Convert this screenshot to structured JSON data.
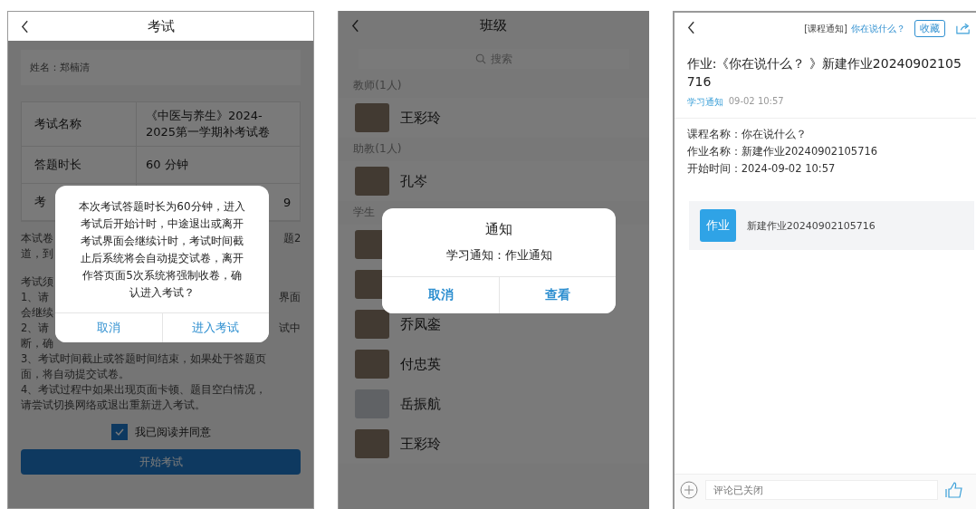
{
  "exam_screen": {
    "title": "考试",
    "name_field": "姓名：郑楠清",
    "info_rows": [
      {
        "label": "考试名称",
        "value": "《中医与养生》2024-2025第一学期补考试卷"
      },
      {
        "label": "答题时长",
        "value": "60 分钟"
      },
      {
        "label": "考",
        "value": "9"
      }
    ],
    "rule_paragraphs": [
      [
        {
          "left": "本试卷",
          "right": "题2"
        },
        {
          "left": "道，到"
        }
      ],
      [
        {
          "left": "考试须"
        },
        {
          "left": "1、请",
          "right": "界面"
        },
        {
          "left": "会继续"
        },
        {
          "left": "2、请",
          "right": "试中"
        },
        {
          "left": "断，确"
        },
        {
          "left": "3、考试时间截止或答题时间结束，如果处于答题页"
        },
        {
          "left": "面，将自动提交试卷。"
        },
        {
          "left": "4、考试过程中如果出现页面卡顿、题目空白情况，"
        },
        {
          "left": "请尝试切换网络或退出重新进入考试。"
        }
      ]
    ],
    "agree": {
      "label": "我已阅读并同意",
      "checked": true
    },
    "start_button": "开始考试",
    "dialog": {
      "message": "本次考试答题时长为60分钟，进入考试后开始计时，中途退出或离开考试界面会继续计时，考试时间截止后系统将会自动提交试卷，离开作答页面5次系统将强制收卷，确认进入考试？",
      "buttons": [
        "取消",
        "进入考试"
      ]
    }
  },
  "class_screen": {
    "title": "班级",
    "search": {
      "placeholder": "搜索"
    },
    "groups": [
      {
        "header": "教师(1人)",
        "members": [
          {
            "default_avatar": false,
            "name": "王彩玲"
          }
        ]
      },
      {
        "header": "助教(1人)",
        "members": [
          {
            "default_avatar": false,
            "name": "孔岑"
          }
        ]
      },
      {
        "header": "学生",
        "members": [
          {
            "default_avatar": false
          },
          {
            "default_avatar": false
          },
          {
            "default_avatar": false,
            "name": "乔凤銮"
          },
          {
            "default_avatar": false,
            "name": "付忠英"
          },
          {
            "default_avatar": true,
            "name": "岳振航"
          },
          {
            "default_avatar": false,
            "name": "王彩玲"
          }
        ]
      }
    ],
    "dialog": {
      "title": "通知",
      "message": "学习通知：作业通知",
      "buttons": [
        "取消",
        "查看"
      ]
    }
  },
  "notice_screen": {
    "header": {
      "category": "[课程通知]",
      "course_link": "你在说什么？",
      "bookmark_button": "收藏"
    },
    "title": "作业:《你在说什么？ 》新建作业20240902105716",
    "tag": "学习通知",
    "time": "09-02 10:57",
    "details": [
      "课程名称：你在说什么？",
      "作业名称：新建作业20240902105716",
      "开始时间：2024-09-02 10:57"
    ],
    "attachment": {
      "badge": "作业",
      "text": "新建作业20240902105716"
    },
    "comment": {
      "placeholder": "评论已关闭"
    }
  }
}
